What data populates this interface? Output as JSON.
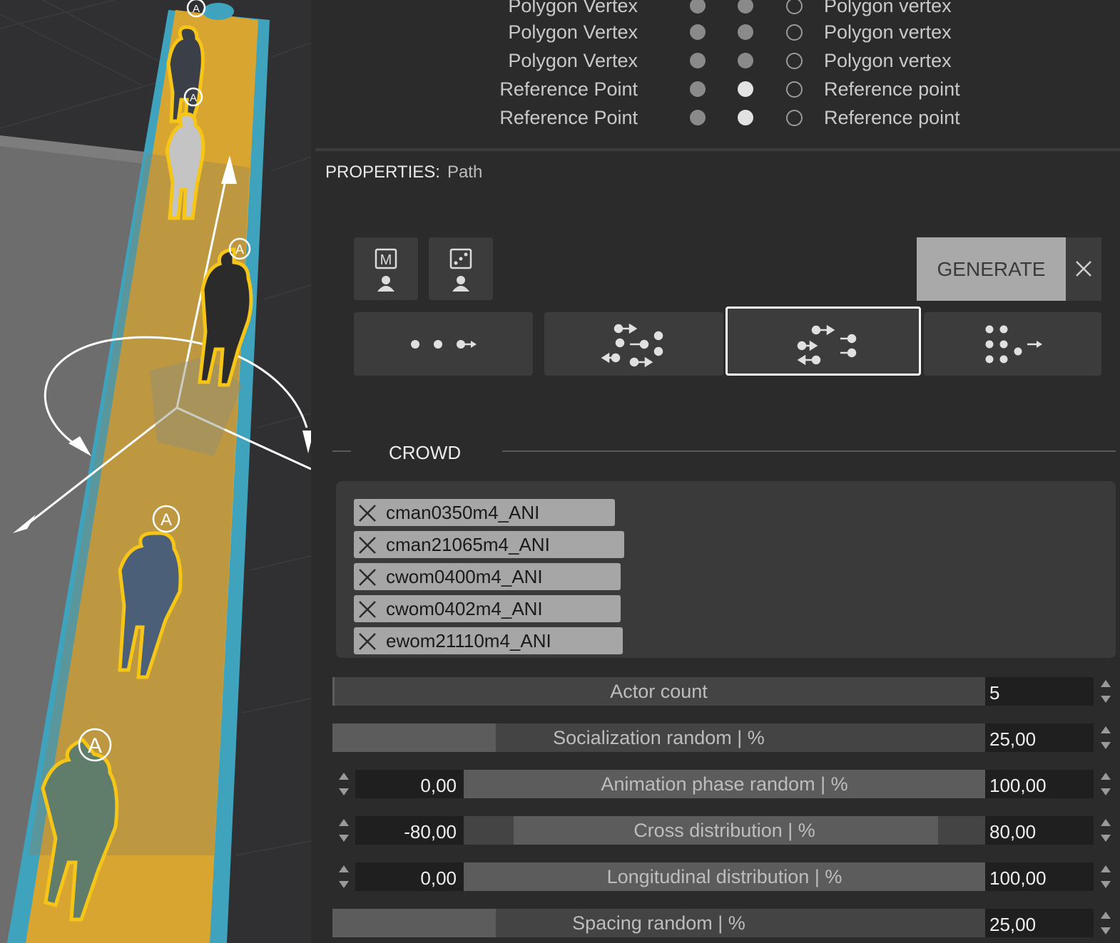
{
  "vertex_table": [
    {
      "name": "Polygon Vertex",
      "dot1": "grey",
      "dot2": "grey",
      "type": "Polygon vertex"
    },
    {
      "name": "Polygon Vertex",
      "dot1": "grey",
      "dot2": "grey",
      "type": "Polygon vertex"
    },
    {
      "name": "Polygon Vertex",
      "dot1": "grey",
      "dot2": "grey",
      "type": "Polygon vertex"
    },
    {
      "name": "Reference Point",
      "dot1": "grey",
      "dot2": "white",
      "type": "Reference point"
    },
    {
      "name": "Reference Point",
      "dot1": "grey",
      "dot2": "white",
      "type": "Reference point"
    }
  ],
  "properties": {
    "label": "PROPERTIES:",
    "value": "Path"
  },
  "toolbar": {
    "generate_label": "GENERATE",
    "manual_actor_icon": "manual-actor-icon",
    "random_actor_icon": "random-actor-icon",
    "close_icon": "close-icon"
  },
  "modes": [
    {
      "name": "single-direction-mode",
      "selected": false
    },
    {
      "name": "mixed-direction-mode",
      "selected": false
    },
    {
      "name": "bidirectional-mode",
      "selected": true
    },
    {
      "name": "group-mode",
      "selected": false
    }
  ],
  "crowd": {
    "title": "CROWD",
    "actors": [
      "cman0350m4_ANI",
      "cman21065m4_ANI",
      "cwom0400m4_ANI",
      "cwom0402m4_ANI",
      "ewom21110m4_ANI"
    ]
  },
  "fields": {
    "actor_count": {
      "label": "Actor count",
      "value": "5"
    },
    "socialization": {
      "label": "Socialization random | %",
      "value": "25,00",
      "fill_fraction": 0.25
    },
    "animation_phase": {
      "label": "Animation phase random | %",
      "min": "0,00",
      "max": "100,00"
    },
    "cross_distribution": {
      "label": "Cross distribution | %",
      "min": "-80,00",
      "max": "80,00"
    },
    "longitudinal_distribution": {
      "label": "Longitudinal distribution | %",
      "min": "0,00",
      "max": "100,00"
    },
    "spacing": {
      "label": "Spacing random | %",
      "value": "25,00",
      "fill_fraction": 0.25
    }
  },
  "colors": {
    "path_yellow": "#d9a531",
    "path_blue": "#3fa3bd",
    "panel_bg": "#2b2b2b",
    "accent_white": "#ffffff"
  }
}
